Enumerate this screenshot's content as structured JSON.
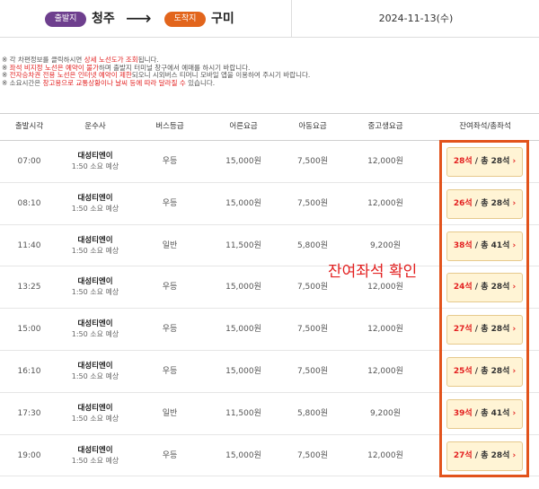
{
  "route": {
    "departure_badge": "출발지",
    "departure_city": "청주",
    "arrival_badge": "도착지",
    "arrival_city": "구미",
    "arrow": "⟶",
    "date": "2024-11-13(수)"
  },
  "notices": [
    {
      "prefix": "※ 각 차편정보를 클릭하시면 ",
      "highlight": "상세 노선도가 조회",
      "suffix": "됩니다."
    },
    {
      "prefix": "※ ",
      "highlight": "좌석 비지정 노선은 예약이 불가",
      "suffix": "하며 출발지 터미널 창구에서 예매를 하시기 바랍니다."
    },
    {
      "prefix": "※ ",
      "highlight": "전자승차권 전용 노선은 인터넷 예약이 제한",
      "suffix": "되오니 시외버스 티머니 모바일 앱을 이용하여 주시기 바랍니다."
    },
    {
      "prefix": "※ 소요시간은 ",
      "highlight": "창고용으로 교통상황이나 날씨 등에 따라 달라질 수",
      "suffix": " 있습니다."
    }
  ],
  "table": {
    "headers": [
      "출발시각",
      "운수사",
      "버스등급",
      "어른요금",
      "아동요금",
      "중고생요금",
      "잔여좌석/총좌석"
    ],
    "rows": [
      {
        "time": "07:00",
        "company": "대성티엔이",
        "duration": "1:50 소요 예상",
        "grade": "우등",
        "adult": "15,000원",
        "child": "7,500원",
        "student": "12,000원",
        "seats_avail": "28석",
        "seats_total": " / 총 28석"
      },
      {
        "time": "08:10",
        "company": "대성티엔이",
        "duration": "1:50 소요 예상",
        "grade": "우등",
        "adult": "15,000원",
        "child": "7,500원",
        "student": "12,000원",
        "seats_avail": "26석",
        "seats_total": " / 총 28석"
      },
      {
        "time": "11:40",
        "company": "대성티엔이",
        "duration": "1:50 소요 예상",
        "grade": "일반",
        "adult": "11,500원",
        "child": "5,800원",
        "student": "9,200원",
        "seats_avail": "38석",
        "seats_total": " / 총 41석"
      },
      {
        "time": "13:25",
        "company": "대성티엔이",
        "duration": "1:50 소요 예상",
        "grade": "우등",
        "adult": "15,000원",
        "child": "7,500원",
        "student": "12,000원",
        "seats_avail": "24석",
        "seats_total": " / 총 28석"
      },
      {
        "time": "15:00",
        "company": "대성티엔이",
        "duration": "1:50 소요 예상",
        "grade": "우등",
        "adult": "15,000원",
        "child": "7,500원",
        "student": "12,000원",
        "seats_avail": "27석",
        "seats_total": " / 총 28석"
      },
      {
        "time": "16:10",
        "company": "대성티엔이",
        "duration": "1:50 소요 예상",
        "grade": "우등",
        "adult": "15,000원",
        "child": "7,500원",
        "student": "12,000원",
        "seats_avail": "25석",
        "seats_total": " / 총 28석"
      },
      {
        "time": "17:30",
        "company": "대성티엔이",
        "duration": "1:50 소요 예상",
        "grade": "일반",
        "adult": "11,500원",
        "child": "5,800원",
        "student": "9,200원",
        "seats_avail": "39석",
        "seats_total": " / 총 41석"
      },
      {
        "time": "19:00",
        "company": "대성티엔이",
        "duration": "1:50 소요 예상",
        "grade": "우등",
        "adult": "15,000원",
        "child": "7,500원",
        "student": "12,000원",
        "seats_avail": "27석",
        "seats_total": " / 총 28석"
      }
    ]
  },
  "annotation": {
    "callout": "잔여좌석 확인",
    "color": "#e2531c"
  },
  "colors": {
    "departure_badge": "#6e3f8e",
    "arrival_badge": "#e2651c",
    "seat_button_bg": "#fff4d5",
    "accent_red": "#e32020"
  },
  "icons": {
    "route_arrow": "arrow-right-icon",
    "seat_chevron": "chevron-right-icon"
  }
}
